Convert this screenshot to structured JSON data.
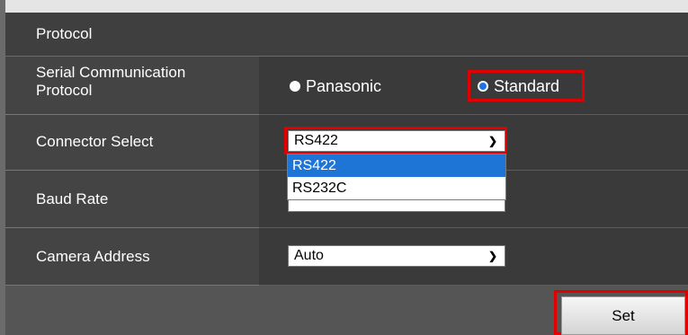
{
  "header": {
    "title": "Protocol"
  },
  "rows": {
    "serial": {
      "label_line1": "Serial Communication",
      "label_line2": "Protocol",
      "options": [
        "Panasonic",
        "Standard"
      ],
      "selected": "Standard"
    },
    "connector": {
      "label": "Connector Select",
      "value": "RS422",
      "options": [
        "RS422",
        "RS232C"
      ],
      "highlighted_option": "RS422"
    },
    "baud": {
      "label": "Baud Rate"
    },
    "address": {
      "label": "Camera Address",
      "value": "Auto"
    }
  },
  "footer": {
    "set_label": "Set"
  },
  "colors": {
    "panel": "#3a3a3a",
    "label_cell": "#444444",
    "highlight": "#e00000",
    "selected_option": "#1e75d6"
  },
  "icons": {
    "select_arrow": "chevron-down-icon"
  }
}
